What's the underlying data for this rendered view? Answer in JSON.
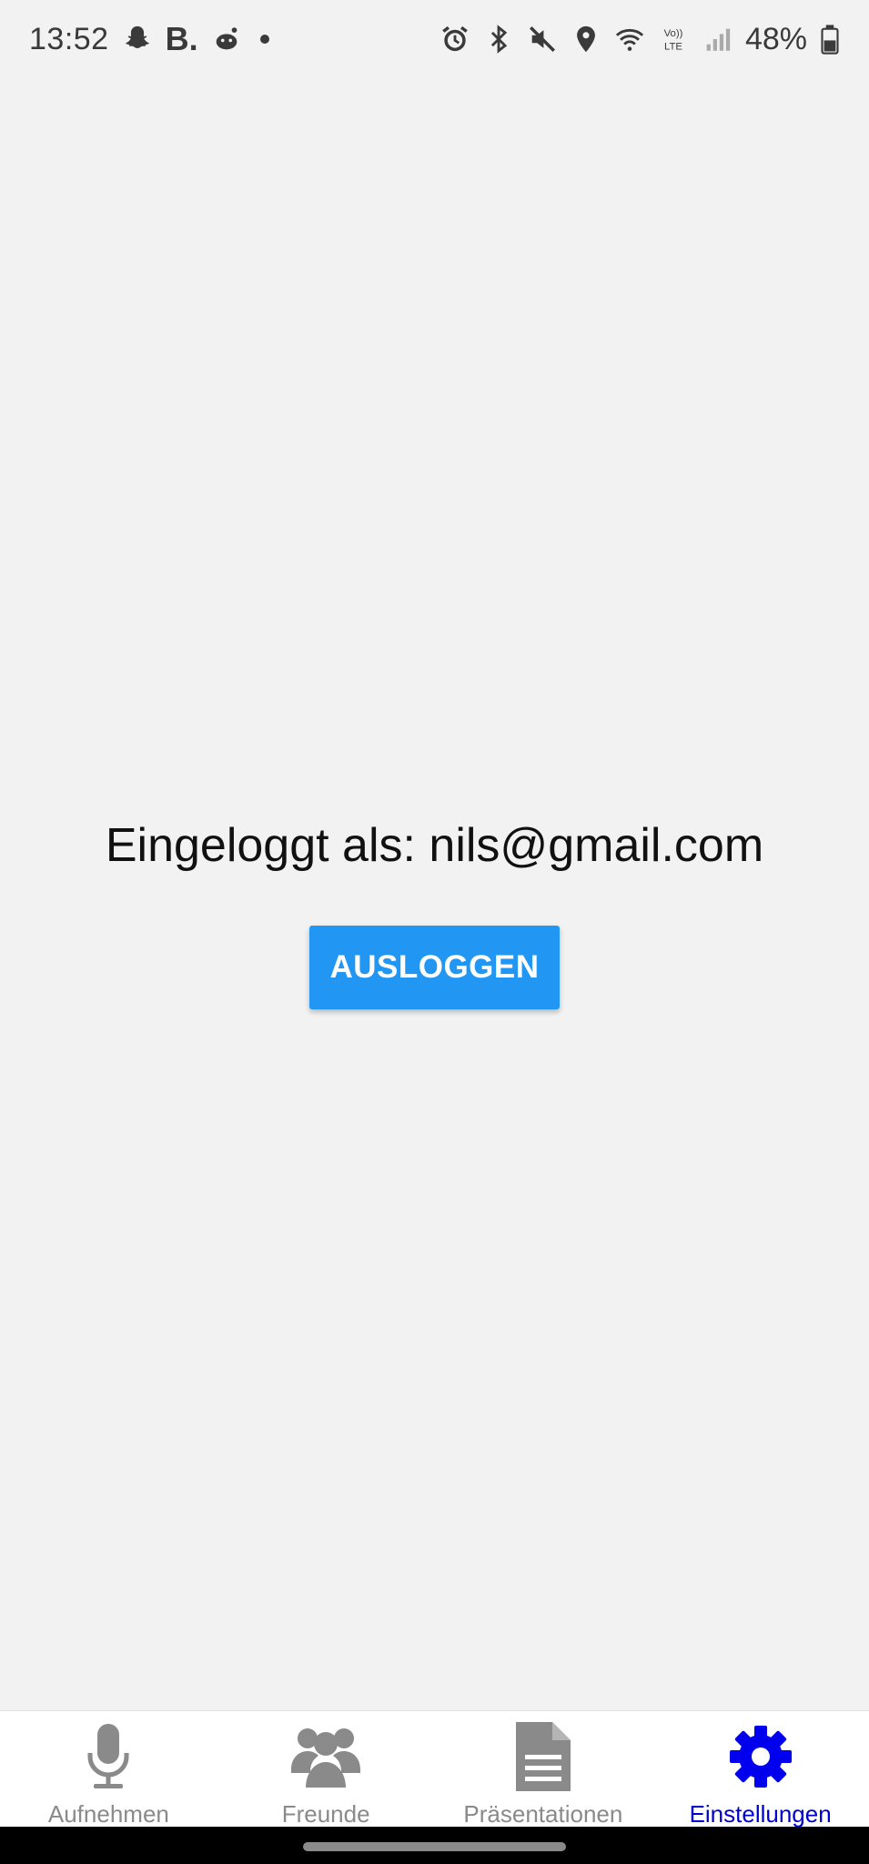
{
  "status_bar": {
    "time": "13:52",
    "b_label": "B.",
    "battery_percent": "48%",
    "volte_label": "Vo)) LTE"
  },
  "main": {
    "logged_in_text": "Eingeloggt als: nils@gmail.com",
    "logout_label": "AUSLOGGEN"
  },
  "tabs": [
    {
      "label": "Aufnehmen",
      "icon": "microphone-icon",
      "active": false
    },
    {
      "label": "Freunde",
      "icon": "people-icon",
      "active": false
    },
    {
      "label": "Präsentationen",
      "icon": "document-icon",
      "active": false
    },
    {
      "label": "Einstellungen",
      "icon": "gear-icon",
      "active": true
    }
  ],
  "colors": {
    "accent": "#2196f3",
    "active_tab": "#0000cc",
    "inactive_tab": "#8a8a8a",
    "background": "#f2f2f2"
  }
}
